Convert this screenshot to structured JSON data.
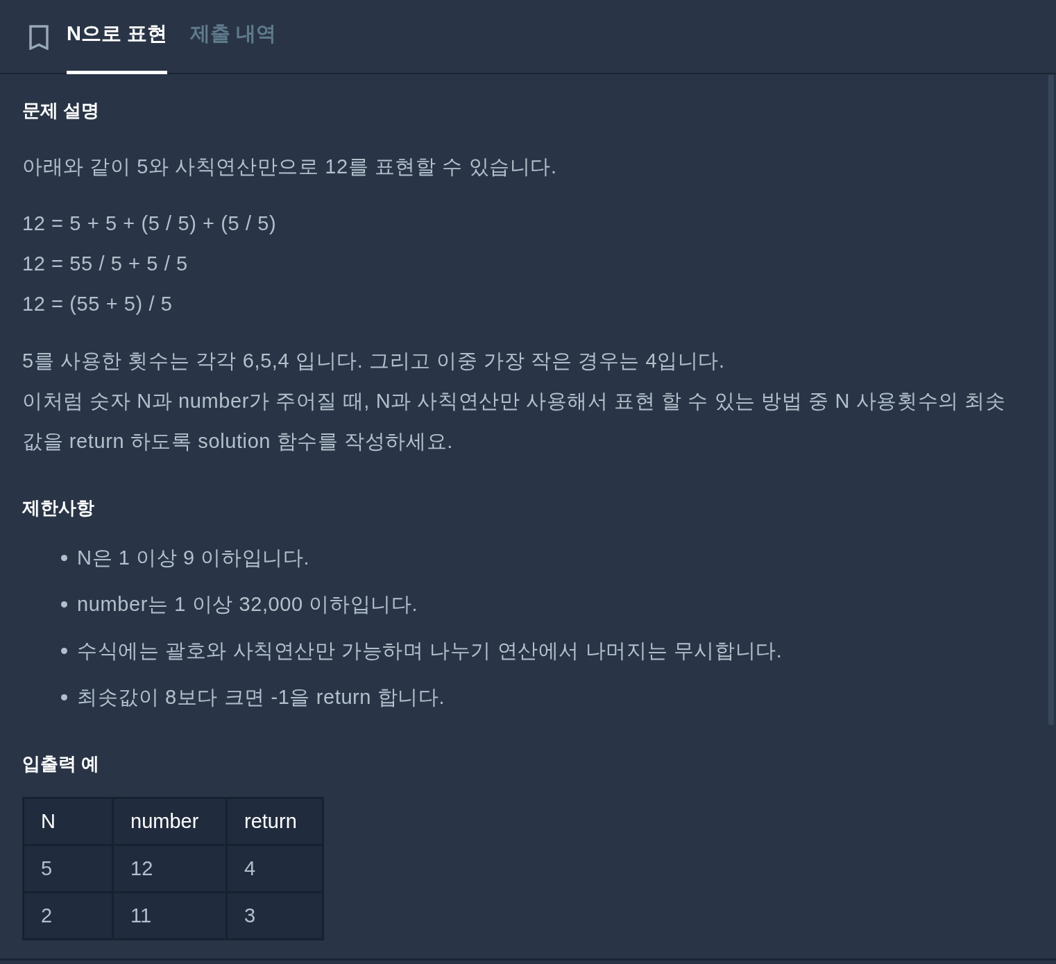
{
  "tabs": [
    {
      "label": "N으로 표현",
      "selected": true
    },
    {
      "label": "제출 내역",
      "selected": false
    }
  ],
  "sections": [
    {
      "heading": "문제 설명",
      "blocks": [
        {
          "kind": "paragraph",
          "lines": [
            "아래와 같이 5와 사칙연산만으로 12를 표현할 수 있습니다."
          ]
        },
        {
          "kind": "paragraph",
          "lines": [
            "12 = 5 + 5 + (5 / 5) + (5 / 5)",
            "12 = 55 / 5 + 5 / 5",
            "12 = (55 + 5) / 5"
          ]
        },
        {
          "kind": "paragraph",
          "lines": [
            "5를 사용한 횟수는 각각 6,5,4 입니다. 그리고 이중 가장 작은 경우는 4입니다.",
            "이처럼 숫자 N과 number가 주어질 때, N과 사칙연산만 사용해서 표현 할 수 있는 방법 중 N 사용횟수의 최솟값을 return 하도록 solution 함수를 작성하세요."
          ]
        }
      ]
    },
    {
      "heading": "제한사항",
      "blocks": [
        {
          "kind": "list",
          "items": [
            "N은 1 이상 9 이하입니다.",
            "number는 1 이상 32,000 이하입니다.",
            "수식에는 괄호와 사칙연산만 가능하며 나누기 연산에서 나머지는 무시합니다.",
            "최솟값이 8보다 크면 -1을 return 합니다."
          ]
        }
      ]
    },
    {
      "heading": "입출력 예",
      "blocks": [
        {
          "kind": "table",
          "columns": [
            "N",
            "number",
            "return"
          ],
          "rows": [
            [
              "5",
              "12",
              "4"
            ],
            [
              "2",
              "11",
              "3"
            ]
          ]
        }
      ]
    }
  ]
}
